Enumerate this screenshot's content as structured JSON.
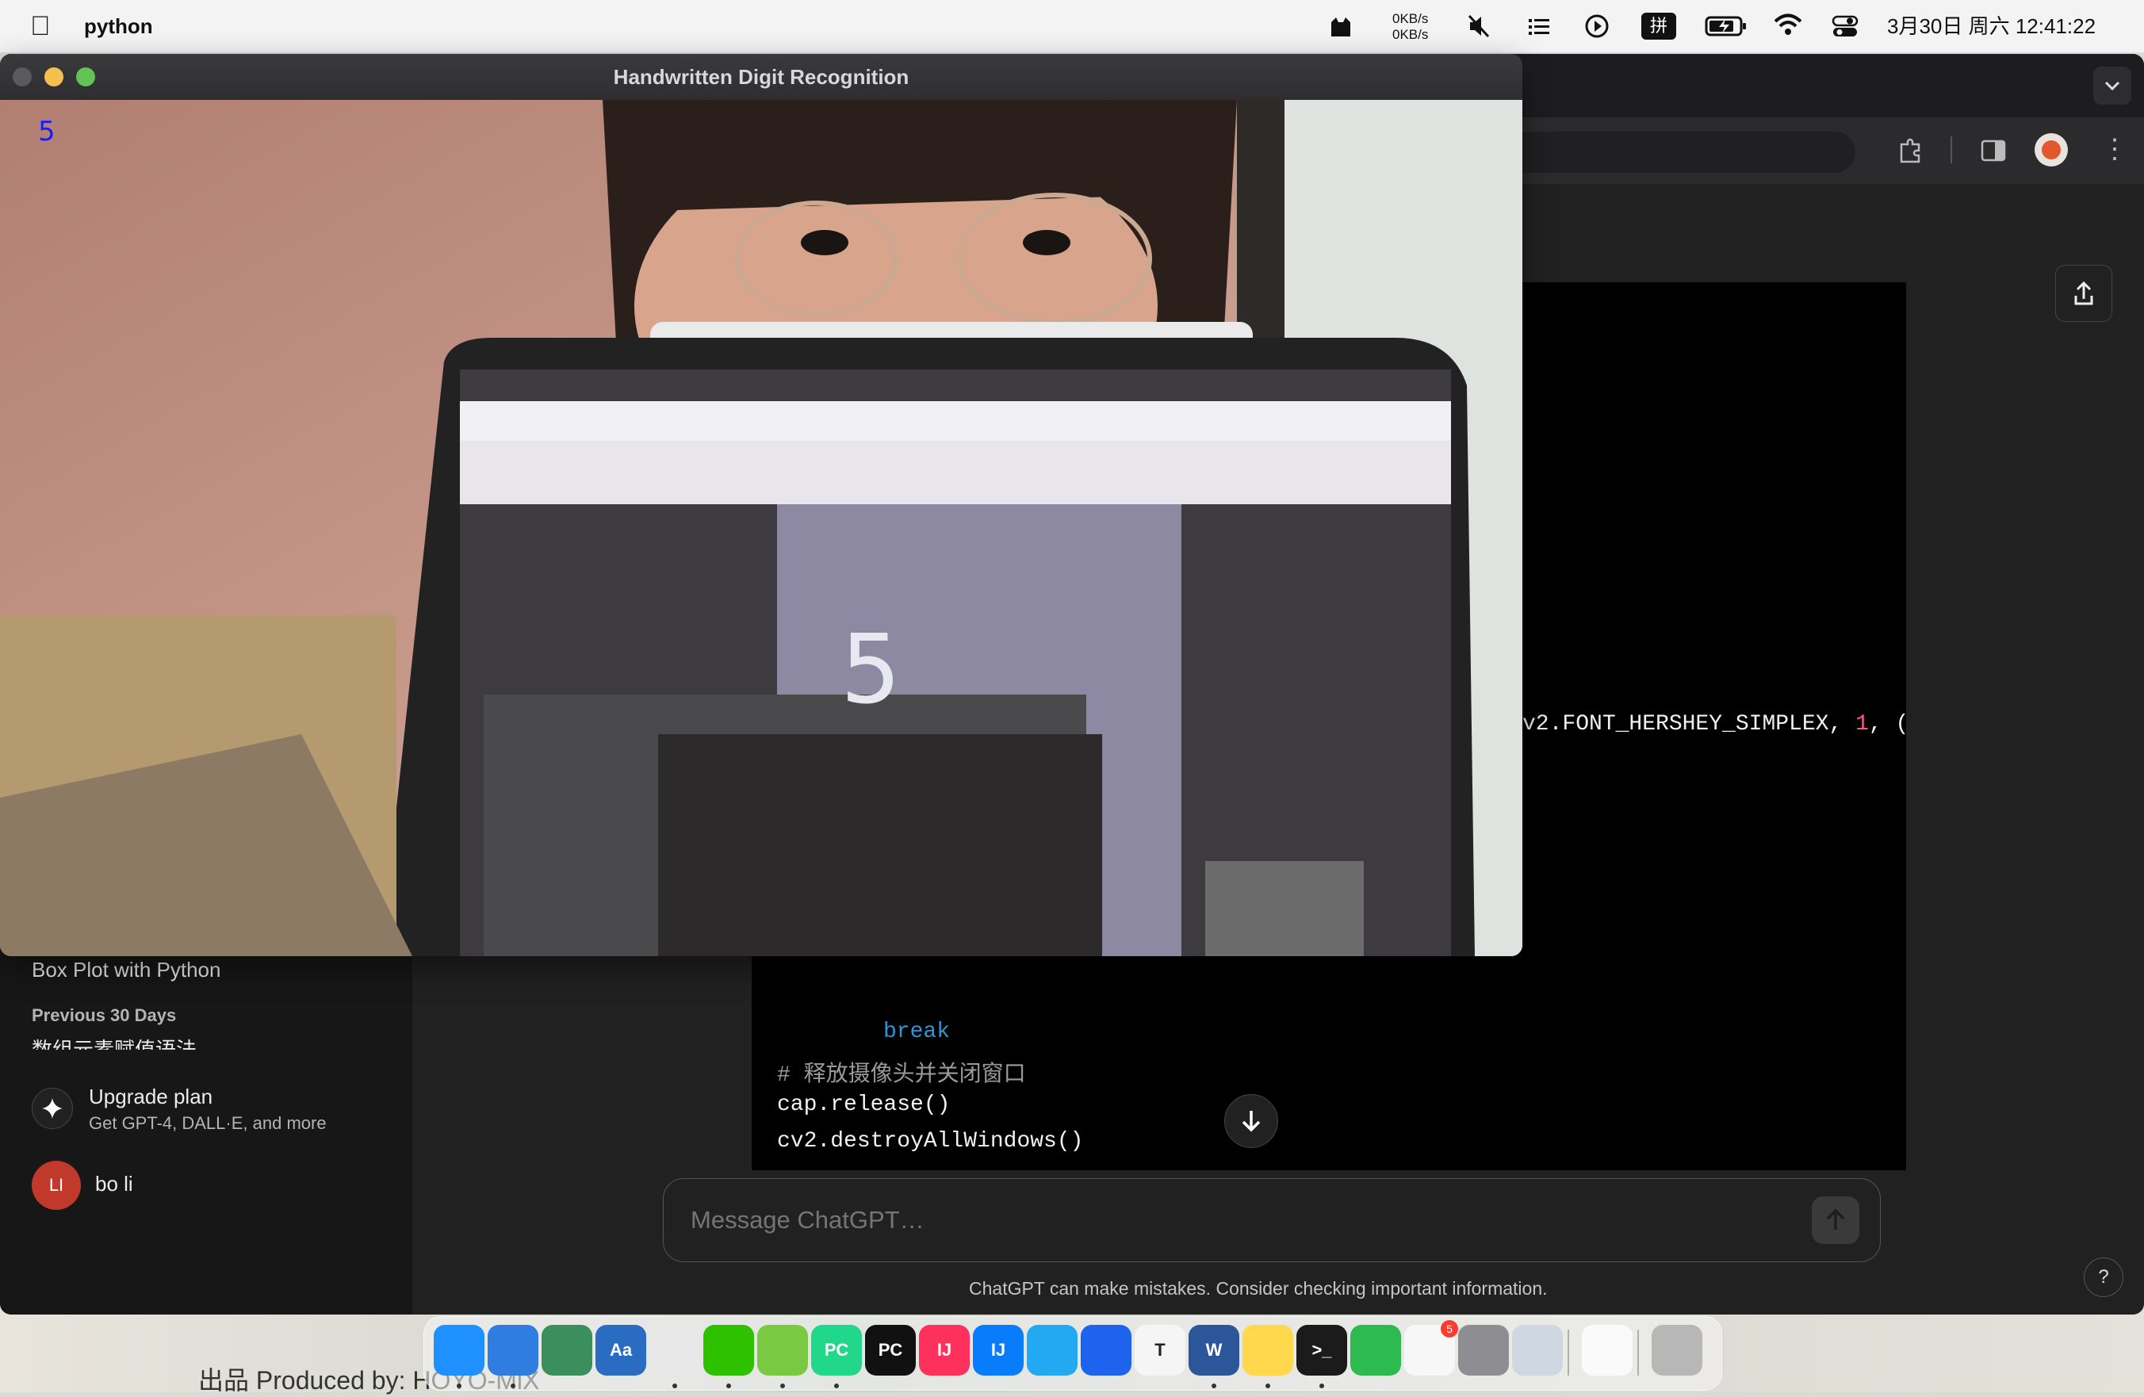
{
  "menubar": {
    "app_name": "python",
    "net_up": "0KB/s",
    "net_down": "0KB/s",
    "datetime": "3月30日 周六  12:41:22"
  },
  "camera_window": {
    "title": "Handwritten Digit Recognition",
    "prediction": "5",
    "prediction_color": "#1a1aff"
  },
  "sidebar": {
    "recent_item": "Box Plot with Python",
    "section_label": "Previous 30 Days",
    "truncated_item": "数组元素赋值语法",
    "upgrade_title": "Upgrade plan",
    "upgrade_subtitle": "Get GPT-4, DALL·E, and more",
    "user_initials": "LI",
    "user_name": "bo li"
  },
  "code": {
    "line_font": "v2.FONT_HERSHEY_SIMPLEX, ",
    "line_font_num": "1",
    "line_font_tail": ", (",
    "line_break": "break",
    "line_comment": "# 释放摄像头并关闭窗口",
    "line_release": "cap.release()",
    "line_destroy": "cv2.destroyAllWindows()"
  },
  "composer": {
    "placeholder": "Message ChatGPT…",
    "disclaimer": "ChatGPT can make mistakes. Consider checking important information.",
    "help": "?"
  },
  "wallpaper": {
    "credit": "出品 Produced by:  HOYO-MiX"
  },
  "dock": {
    "apps": [
      {
        "name": "finder-icon",
        "label": "",
        "color": "#1e90ff"
      },
      {
        "name": "qq-icon",
        "label": "",
        "color": "#2f7de1"
      },
      {
        "name": "mindnode-icon",
        "label": "",
        "color": "#3a8f5c"
      },
      {
        "name": "dictionary-icon",
        "label": "Aa",
        "color": "#2a6cc2"
      },
      {
        "name": "chrome-icon",
        "label": "",
        "color": "#e8e8e8"
      },
      {
        "name": "wechat-icon",
        "label": "",
        "color": "#2dc100"
      },
      {
        "name": "aichat-icon",
        "label": "",
        "color": "#7ac943"
      },
      {
        "name": "pycharm-icon",
        "label": "PC",
        "color": "#21d789"
      },
      {
        "name": "pycharm-ce-icon",
        "label": "PC",
        "color": "#111"
      },
      {
        "name": "intellij-icon",
        "label": "IJ",
        "color": "#fe315d"
      },
      {
        "name": "intellij-ce-icon",
        "label": "IJ",
        "color": "#087cfa"
      },
      {
        "name": "vscode-icon",
        "label": "",
        "color": "#23a9f2"
      },
      {
        "name": "docker-icon",
        "label": "",
        "color": "#1d63ed"
      },
      {
        "name": "typora-icon",
        "label": "T",
        "color": "#f5f5f5"
      },
      {
        "name": "word-icon",
        "label": "W",
        "color": "#2b579a"
      },
      {
        "name": "notes-icon",
        "label": "",
        "color": "#ffd84c"
      },
      {
        "name": "terminal-icon",
        "label": ">_",
        "color": "#1b1b1b"
      },
      {
        "name": "numbers-icon",
        "label": "",
        "color": "#2dba4e"
      },
      {
        "name": "reminders-icon",
        "label": "",
        "color": "#f7f7f7"
      },
      {
        "name": "system-settings-icon",
        "label": "",
        "color": "#8d8d92"
      },
      {
        "name": "preview-icon",
        "label": "",
        "color": "#cfd8e0"
      },
      {
        "name": "document-icon",
        "label": "",
        "color": "#fafafa"
      },
      {
        "name": "trash-icon",
        "label": "",
        "color": "#b7b7b7"
      }
    ],
    "reminders_badge": "5"
  }
}
